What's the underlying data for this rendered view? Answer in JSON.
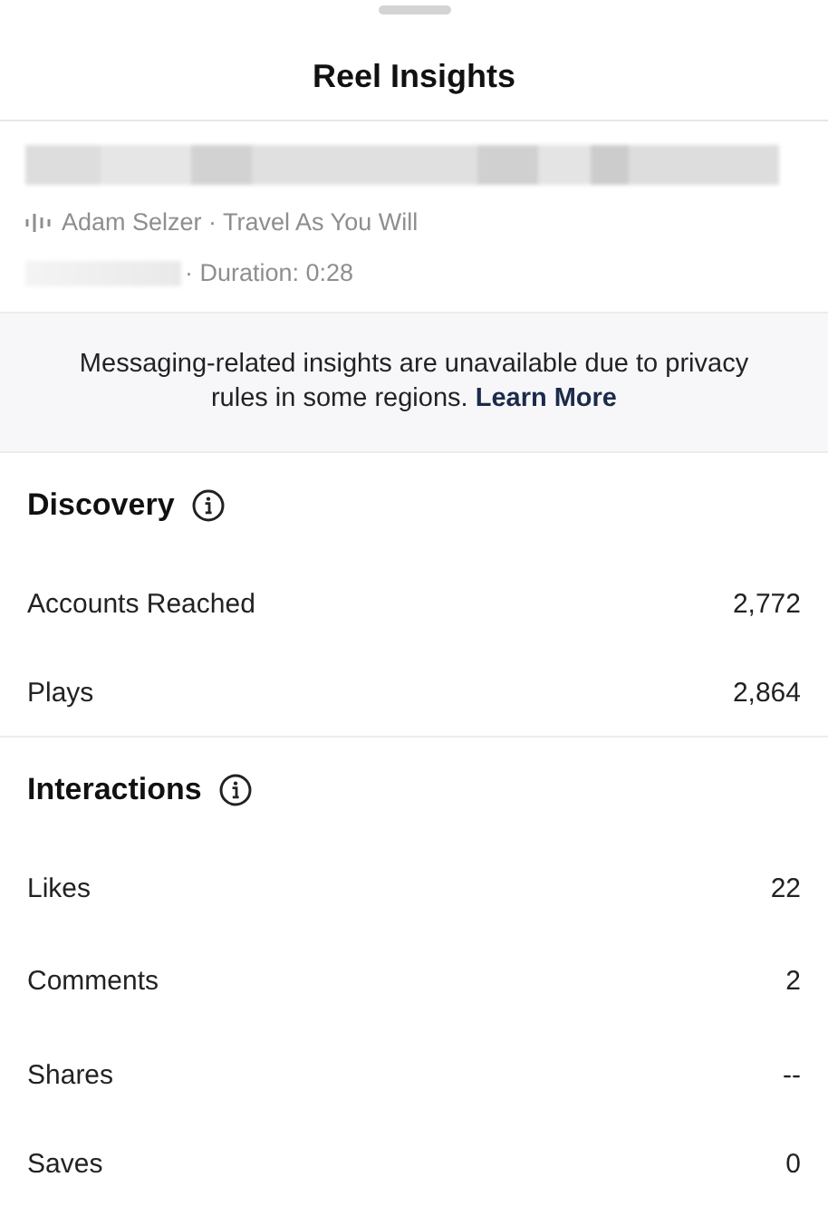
{
  "header": {
    "title": "Reel Insights"
  },
  "reel": {
    "audio": "Adam Selzer · Travel As You Will",
    "duration": "· Duration: 0:28"
  },
  "notice": {
    "text": "Messaging-related insights are unavailable due to privacy rules in some regions.",
    "link": "Learn More"
  },
  "sections": [
    {
      "title": "Discovery",
      "rows": [
        {
          "label": "Accounts Reached",
          "value": "2,772"
        },
        {
          "label": "Plays",
          "value": "2,864"
        }
      ]
    },
    {
      "title": "Interactions",
      "rows": [
        {
          "label": "Likes",
          "value": "22"
        },
        {
          "label": "Comments",
          "value": "2"
        },
        {
          "label": "Shares",
          "value": "--"
        },
        {
          "label": "Saves",
          "value": "0"
        }
      ]
    }
  ]
}
